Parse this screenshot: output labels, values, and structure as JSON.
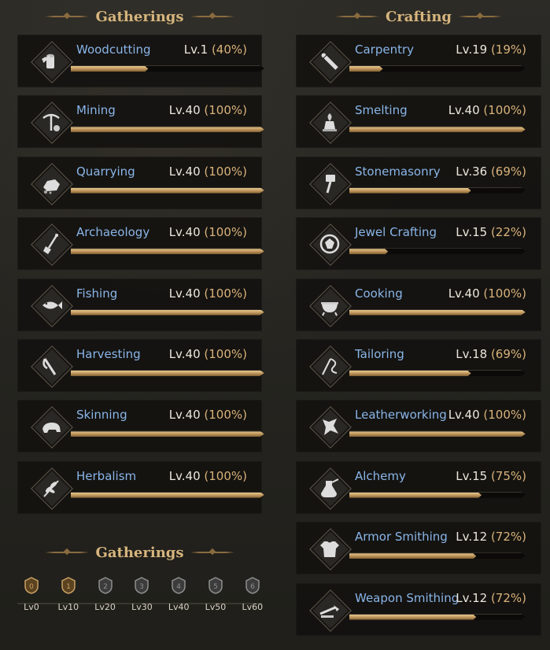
{
  "sections": {
    "gathering_title": "Gatherings",
    "crafting_title": "Crafting",
    "tiers_title": "Gatherings"
  },
  "colors": {
    "name": "#8ab5e8",
    "level": "#ece7dc",
    "percent": "#d9b27a",
    "title": "#d6b57d",
    "bar_fill": "#c9a064",
    "card_bg": "#12110f"
  },
  "gathering": [
    {
      "name": "Woodcutting",
      "level": "Lv.1",
      "percent": "(40%)",
      "progress": 0.4,
      "icon": "woodcutting-icon"
    },
    {
      "name": "Mining",
      "level": "Lv.40",
      "percent": "(100%)",
      "progress": 1.0,
      "icon": "mining-icon"
    },
    {
      "name": "Quarrying",
      "level": "Lv.40",
      "percent": "(100%)",
      "progress": 1.0,
      "icon": "quarrying-icon"
    },
    {
      "name": "Archaeology",
      "level": "Lv.40",
      "percent": "(100%)",
      "progress": 1.0,
      "icon": "archaeology-icon"
    },
    {
      "name": "Fishing",
      "level": "Lv.40",
      "percent": "(100%)",
      "progress": 1.0,
      "icon": "fishing-icon"
    },
    {
      "name": "Harvesting",
      "level": "Lv.40",
      "percent": "(100%)",
      "progress": 1.0,
      "icon": "harvesting-icon"
    },
    {
      "name": "Skinning",
      "level": "Lv.40",
      "percent": "(100%)",
      "progress": 1.0,
      "icon": "skinning-icon"
    },
    {
      "name": "Herbalism",
      "level": "Lv.40",
      "percent": "(100%)",
      "progress": 1.0,
      "icon": "herbalism-icon"
    }
  ],
  "crafting": [
    {
      "name": "Carpentry",
      "level": "Lv.19",
      "percent": "(19%)",
      "progress": 0.19,
      "icon": "carpentry-icon"
    },
    {
      "name": "Smelting",
      "level": "Lv.40",
      "percent": "(100%)",
      "progress": 1.0,
      "icon": "smelting-icon"
    },
    {
      "name": "Stonemasonry",
      "level": "Lv.36",
      "percent": "(69%)",
      "progress": 0.69,
      "icon": "stonemasonry-icon"
    },
    {
      "name": "Jewel Crafting",
      "level": "Lv.15",
      "percent": "(22%)",
      "progress": 0.22,
      "icon": "jewel-crafting-icon"
    },
    {
      "name": "Cooking",
      "level": "Lv.40",
      "percent": "(100%)",
      "progress": 1.0,
      "icon": "cooking-icon"
    },
    {
      "name": "Tailoring",
      "level": "Lv.18",
      "percent": "(69%)",
      "progress": 0.69,
      "icon": "tailoring-icon"
    },
    {
      "name": "Leatherworking",
      "level": "Lv.40",
      "percent": "(100%)",
      "progress": 1.0,
      "icon": "leatherworking-icon"
    },
    {
      "name": "Alchemy",
      "level": "Lv.15",
      "percent": "(75%)",
      "progress": 0.75,
      "icon": "alchemy-icon"
    },
    {
      "name": "Armor Smithing",
      "level": "Lv.12",
      "percent": "(72%)",
      "progress": 0.72,
      "icon": "armor-smithing-icon"
    },
    {
      "name": "Weapon Smithing",
      "level": "Lv.12",
      "percent": "(72%)",
      "progress": 0.72,
      "icon": "weapon-smithing-icon"
    }
  ],
  "tiers": [
    {
      "label": "Lv0",
      "badge": "0",
      "active": true
    },
    {
      "label": "Lv10",
      "badge": "1",
      "active": true
    },
    {
      "label": "Lv20",
      "badge": "2",
      "active": false
    },
    {
      "label": "Lv30",
      "badge": "3",
      "active": false
    },
    {
      "label": "Lv40",
      "badge": "4",
      "active": false
    },
    {
      "label": "Lv50",
      "badge": "5",
      "active": false
    },
    {
      "label": "Lv60",
      "badge": "6",
      "active": false
    }
  ]
}
